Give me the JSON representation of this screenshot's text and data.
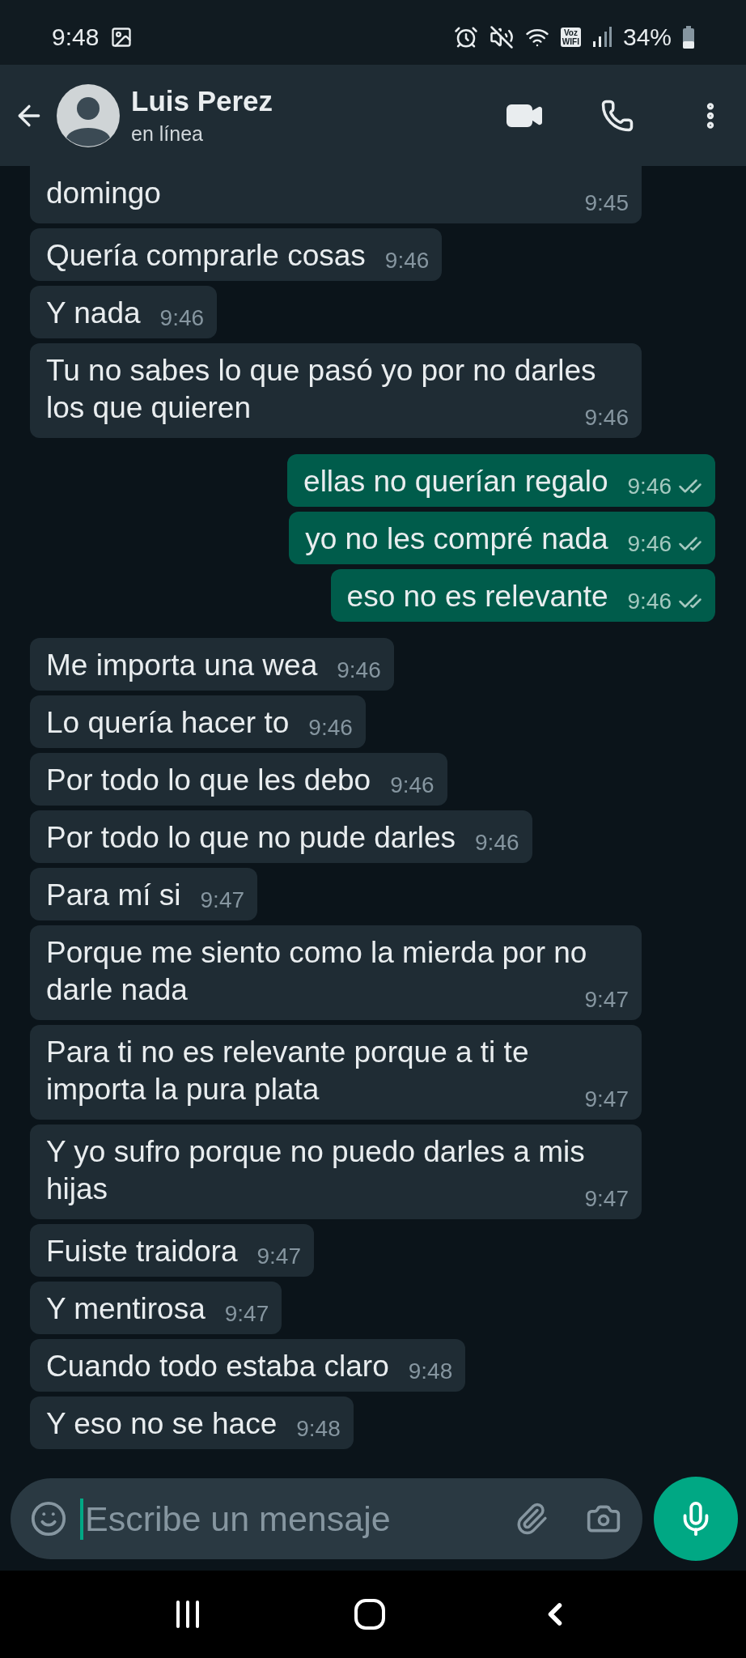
{
  "status_bar": {
    "time": "9:48",
    "vowifi_badge": [
      "Voz",
      "WIFI"
    ],
    "battery": "34%"
  },
  "header": {
    "name": "Luis Perez",
    "status": "en línea"
  },
  "messages": [
    {
      "outgoing": false,
      "kind": "cut",
      "text": "domingo",
      "time": "9:45"
    },
    {
      "outgoing": false,
      "kind": "single",
      "text": "Quería comprarle cosas",
      "time": "9:46"
    },
    {
      "outgoing": false,
      "kind": "single",
      "text": "Y nada",
      "time": "9:46"
    },
    {
      "outgoing": false,
      "kind": "wrap",
      "text": "Tu no sabes lo que pasó yo por no darles los que quieren",
      "time": "9:46"
    },
    {
      "outgoing": true,
      "kind": "single",
      "text": "ellas no querían regalo",
      "time": "9:46",
      "read": false
    },
    {
      "outgoing": true,
      "kind": "single",
      "text": "yo no les compré nada",
      "time": "9:46",
      "read": false
    },
    {
      "outgoing": true,
      "kind": "single",
      "text": "eso no es relevante",
      "time": "9:46",
      "read": false
    },
    {
      "outgoing": false,
      "kind": "single",
      "text": "Me importa una wea",
      "time": "9:46"
    },
    {
      "outgoing": false,
      "kind": "single",
      "text": "Lo quería hacer to",
      "time": "9:46"
    },
    {
      "outgoing": false,
      "kind": "single",
      "text": "Por todo lo que les debo",
      "time": "9:46"
    },
    {
      "outgoing": false,
      "kind": "single",
      "text": "Por todo lo que no pude darles",
      "time": "9:46"
    },
    {
      "outgoing": false,
      "kind": "single",
      "text": "Para mí si",
      "time": "9:47"
    },
    {
      "outgoing": false,
      "kind": "wrap",
      "text": "Porque me siento como la mierda por no darle nada",
      "time": "9:47"
    },
    {
      "outgoing": false,
      "kind": "wrap",
      "text": "Para ti no es relevante porque a ti te importa la pura plata",
      "time": "9:47"
    },
    {
      "outgoing": false,
      "kind": "wrap",
      "text": "Y yo sufro porque no puedo darles a mis hijas",
      "time": "9:47"
    },
    {
      "outgoing": false,
      "kind": "single",
      "text": "Fuiste traidora",
      "time": "9:47"
    },
    {
      "outgoing": false,
      "kind": "single",
      "text": "Y mentirosa",
      "time": "9:47"
    },
    {
      "outgoing": false,
      "kind": "single",
      "text": "Cuando todo estaba claro",
      "time": "9:48"
    },
    {
      "outgoing": false,
      "kind": "single",
      "text": "Y eso no se hace",
      "time": "9:48"
    }
  ],
  "composer": {
    "placeholder": "Escribe un mensaje"
  }
}
